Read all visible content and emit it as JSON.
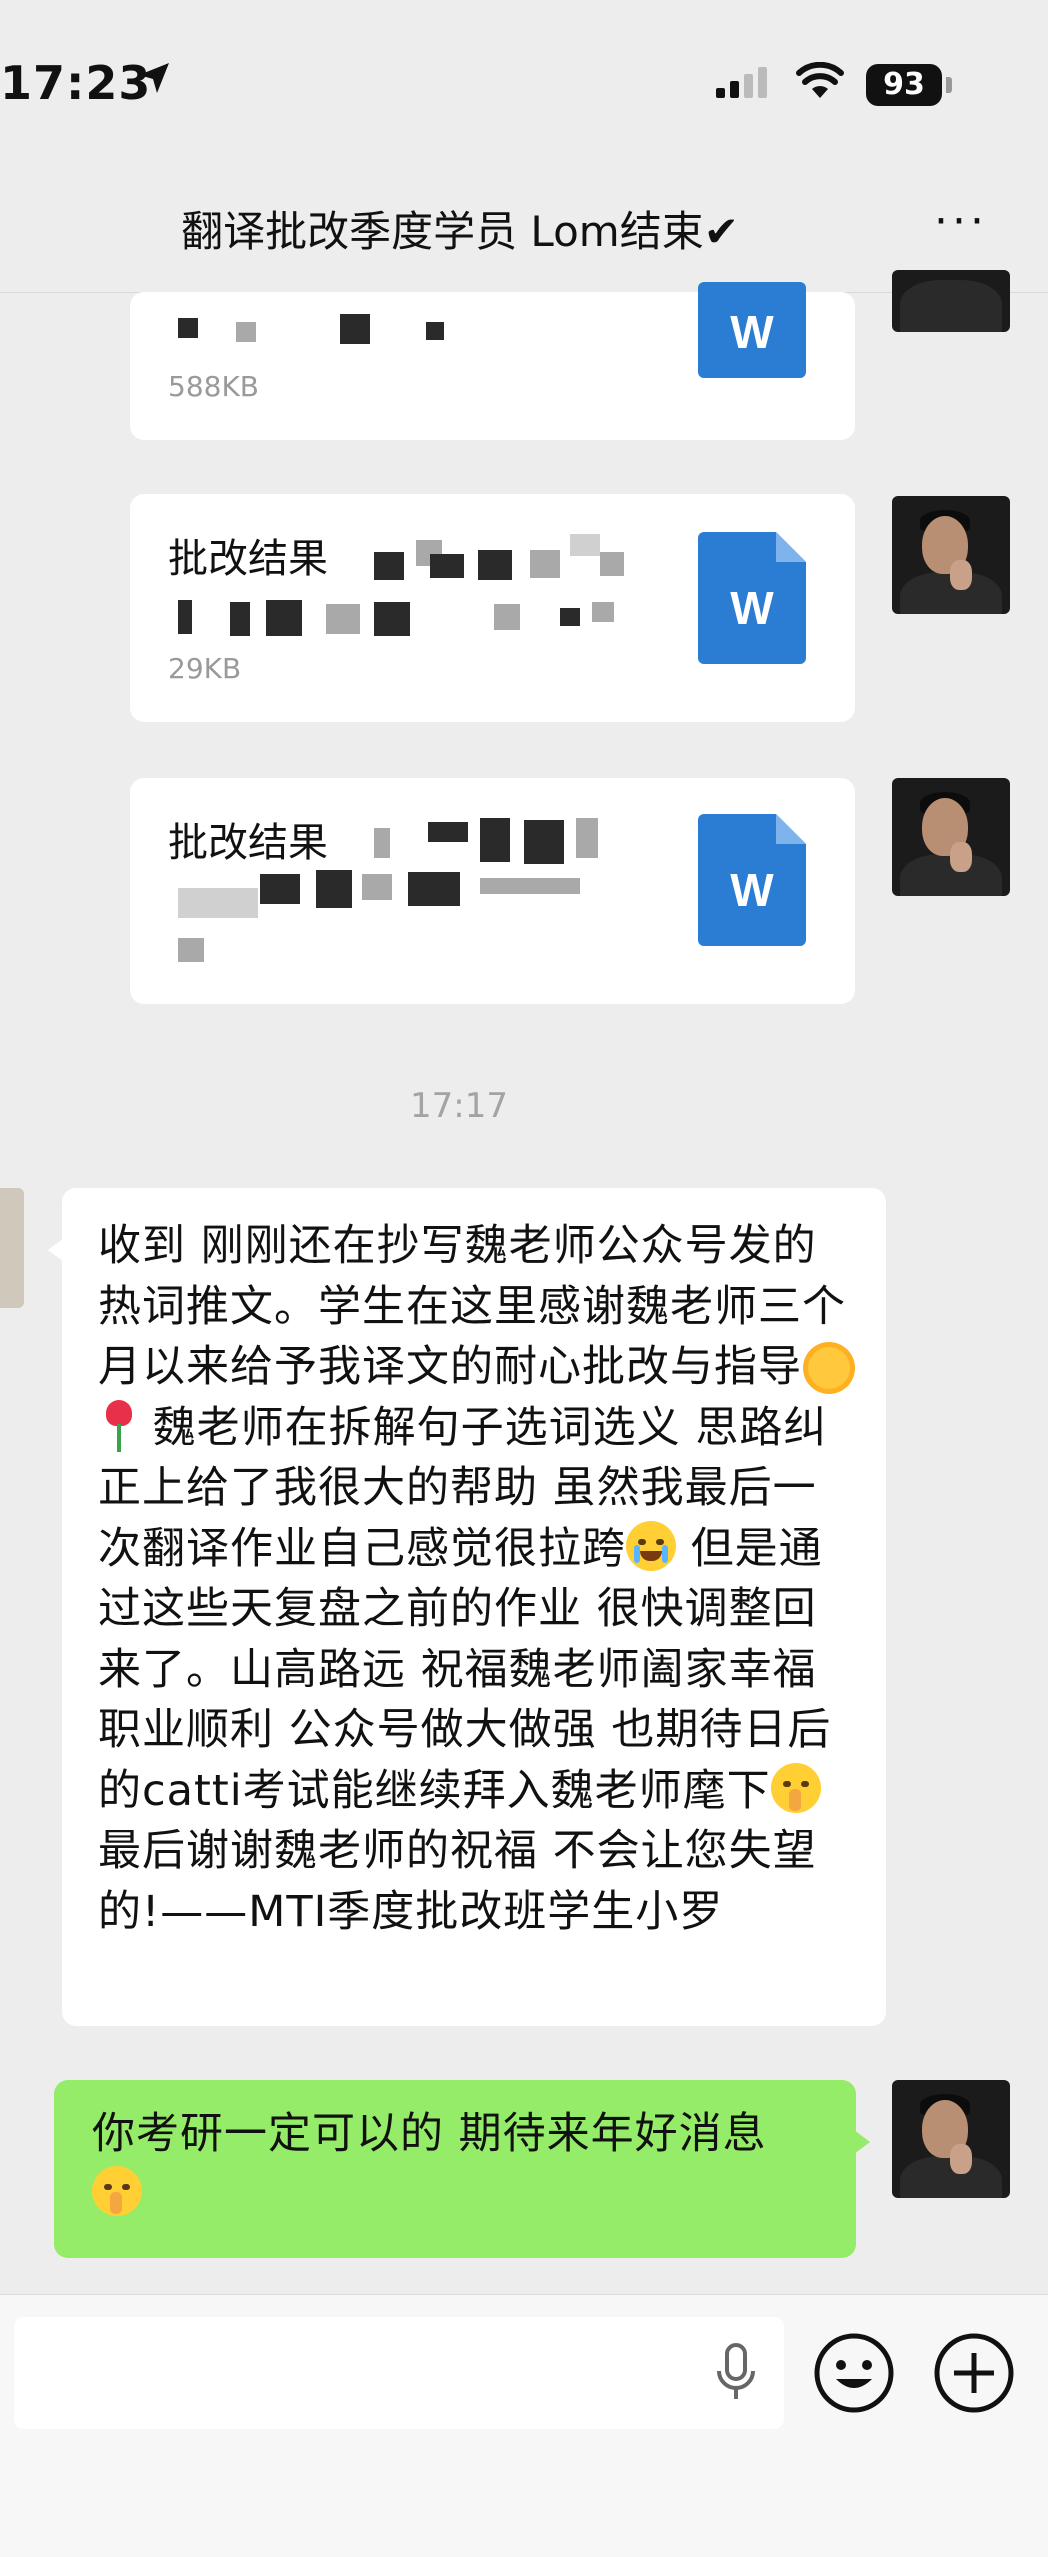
{
  "status_bar": {
    "time": "17:23",
    "battery": "93"
  },
  "header": {
    "title": "翻译批改季度学员 Lom结束✔",
    "more": "···"
  },
  "files": [
    {
      "name": "",
      "size": "588KB",
      "icon_label": "W"
    },
    {
      "name": "批改结果",
      "size": "29KB",
      "icon_label": "W"
    },
    {
      "name": "批改结果",
      "size": "",
      "icon_label": "W"
    }
  ],
  "timestamp": "17:17",
  "message_in": {
    "part1": "收到 刚刚还在抄写魏老师公众号发的热词推文。学生在这里感谢魏老师三个月以来给予我译文的耐心批改与指导",
    "part2": " 魏老师在拆解句子选词选义 思路纠正上给了我很大的帮助 虽然我最后一次翻译作业自己感觉很拉跨",
    "part3": " 但是通过这些天复盘之前的作业 很快调整回来了。山高路远 祝福魏老师阖家幸福 职业顺利 公众号做大做强 也期待日后的catti考试能继续拜入魏老师麾下",
    "part4": " 最后谢谢魏老师的祝福 不会让您失望的!——MTI季度批改班学生小罗"
  },
  "message_out": {
    "text": "你考研一定可以的 期待来年好消息"
  },
  "icons": {
    "location": "location-arrow-icon",
    "signal": "cellular-signal-icon",
    "wifi": "wifi-icon",
    "word": "word-document-icon",
    "mic": "microphone-icon",
    "emoji": "emoji-smile-icon",
    "plus": "plus-circle-icon"
  },
  "colors": {
    "bubble_out": "#95ec69",
    "word_blue": "#2b7cd3",
    "background": "#ededed"
  }
}
